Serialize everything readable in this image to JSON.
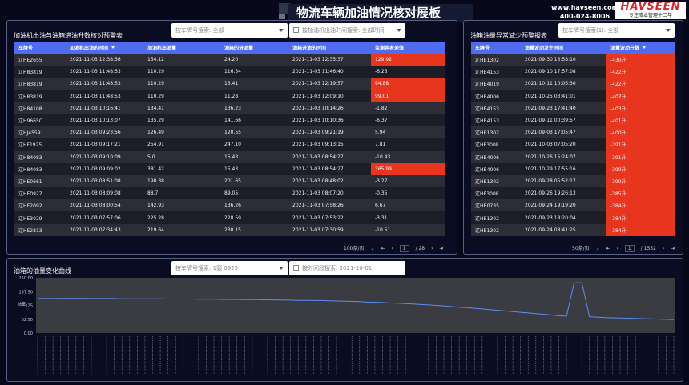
{
  "header": {
    "title": "物流车辆加油情况核对展板",
    "website": "www.havseen.com",
    "phone": "400-024-8006",
    "logo_text": "HAVSEEN",
    "logo_slogan": "专注成本管理十二年"
  },
  "left_panel": {
    "title": "加油机出油与油箱进油升数核对预警表",
    "filter_plate_placeholder": "按车牌号搜索: 全部",
    "filter_time_placeholder": "按加油机出油时间搜索: 全部时间",
    "columns": [
      "车牌号",
      "加油机出油的时间",
      "加油机出油量",
      "油箱的进油量",
      "油箱进油的时间",
      "监测两者差值"
    ],
    "rows": [
      {
        "plate": "辽HE2655",
        "pump_time": "2021-11-03 12:38:56",
        "pump_qty": "154.12",
        "tank_qty": "24.20",
        "tank_time": "2021-11-03 12:35:37",
        "diff": "129.92",
        "alert": true
      },
      {
        "plate": "辽H83819",
        "pump_time": "2021-11-03 11:48:53",
        "pump_qty": "110.29",
        "tank_qty": "116.54",
        "tank_time": "2021-11-03 11:46:40",
        "diff": "-6.25",
        "alert": false
      },
      {
        "plate": "辽H83819",
        "pump_time": "2021-11-03 11:48:53",
        "pump_qty": "110.29",
        "tank_qty": "15.41",
        "tank_time": "2021-11-03 12:19:57",
        "diff": "94.88",
        "alert": true
      },
      {
        "plate": "辽H83819",
        "pump_time": "2021-11-03 11:48:53",
        "pump_qty": "110.29",
        "tank_qty": "11.28",
        "tank_time": "2021-11-03 12:09:10",
        "diff": "99.01",
        "alert": true
      },
      {
        "plate": "辽H84108",
        "pump_time": "2021-11-03 10:16:41",
        "pump_qty": "134.41",
        "tank_qty": "136.23",
        "tank_time": "2021-11-03 10:14:26",
        "diff": "-1.82",
        "alert": false
      },
      {
        "plate": "辽H9665C",
        "pump_time": "2021-11-03 10:13:07",
        "pump_qty": "135.29",
        "tank_qty": "141.66",
        "tank_time": "2021-11-03 10:10:36",
        "diff": "-6.37",
        "alert": false
      },
      {
        "plate": "辽HJ4559",
        "pump_time": "2021-11-03 09:23:56",
        "pump_qty": "126.49",
        "tank_qty": "120.55",
        "tank_time": "2021-11-03 09:21:19",
        "diff": "5.94",
        "alert": false
      },
      {
        "plate": "辽HF1925",
        "pump_time": "2021-11-03 09:17:21",
        "pump_qty": "254.91",
        "tank_qty": "247.10",
        "tank_time": "2021-11-03 09:13:15",
        "diff": "7.81",
        "alert": false
      },
      {
        "plate": "辽H84083",
        "pump_time": "2021-11-03 09:10:09",
        "pump_qty": "5.0",
        "tank_qty": "15.43",
        "tank_time": "2021-11-03 08:54:27",
        "diff": "-10.43",
        "alert": false
      },
      {
        "plate": "辽H84083",
        "pump_time": "2021-11-03 09:09:02",
        "pump_qty": "381.42",
        "tank_qty": "15.43",
        "tank_time": "2021-11-03 08:54:27",
        "diff": "365.99",
        "alert": true
      },
      {
        "plate": "辽HE0661",
        "pump_time": "2021-11-03 08:51:08",
        "pump_qty": "198.38",
        "tank_qty": "201.65",
        "tank_time": "2021-11-03 08:48:02",
        "diff": "-3.27",
        "alert": false
      },
      {
        "plate": "辽HE0927",
        "pump_time": "2021-11-03 08:09:08",
        "pump_qty": "88.7",
        "tank_qty": "89.05",
        "tank_time": "2021-11-03 08:07:20",
        "diff": "-0.35",
        "alert": false
      },
      {
        "plate": "辽HE2092",
        "pump_time": "2021-11-03 08:00:54",
        "pump_qty": "142.93",
        "tank_qty": "136.26",
        "tank_time": "2021-11-03 07:58:26",
        "diff": "6.67",
        "alert": false
      },
      {
        "plate": "辽HE3029",
        "pump_time": "2021-11-03 07:57:06",
        "pump_qty": "225.28",
        "tank_qty": "228.59",
        "tank_time": "2021-11-03 07:53:22",
        "diff": "-3.31",
        "alert": false
      },
      {
        "plate": "辽HE2813",
        "pump_time": "2021-11-03 07:34:43",
        "pump_qty": "219.64",
        "tank_qty": "230.15",
        "tank_time": "2021-11-03 07:30:59",
        "diff": "-10.51",
        "alert": false
      }
    ],
    "pager": {
      "page_size": "100条/页",
      "current_page": "1",
      "total_pages": "/ 28"
    }
  },
  "right_panel": {
    "title": "油箱油量异常减少预警报表",
    "filter_plate_placeholder": "按车牌号搜索(1): 全部",
    "columns": [
      "车牌号",
      "油量波动发生时间",
      "油量波动升数"
    ],
    "rows": [
      {
        "plate": "辽HB1302",
        "time": "2021-09-30 13:58:10",
        "amount": "-430升"
      },
      {
        "plate": "辽HB4153",
        "time": "2021-09-10 17:57:08",
        "amount": "-422升"
      },
      {
        "plate": "辽HB4019",
        "time": "2021-10-11 10:05:30",
        "amount": "-422升"
      },
      {
        "plate": "辽HB4006",
        "time": "2021-10-25 03:41:01",
        "amount": "-407升"
      },
      {
        "plate": "辽HB4153",
        "time": "2021-09-23 17:41:40",
        "amount": "-403升"
      },
      {
        "plate": "辽HB4153",
        "time": "2021-09-11 00:39:57",
        "amount": "-401升"
      },
      {
        "plate": "辽HB1302",
        "time": "2021-09-03 17:05:47",
        "amount": "-400升"
      },
      {
        "plate": "辽HE3008",
        "time": "2021-10-03 07:05:20",
        "amount": "-391升"
      },
      {
        "plate": "辽HB4006",
        "time": "2021-10-26 15:24:07",
        "amount": "-391升"
      },
      {
        "plate": "辽HB4006",
        "time": "2021-10-29 17:55:16",
        "amount": "-390升"
      },
      {
        "plate": "辽HB1302",
        "time": "2021-09-28 05:52:17",
        "amount": "-390升"
      },
      {
        "plate": "辽HE3008",
        "time": "2021-09-26 19:26:13",
        "amount": "-385升"
      },
      {
        "plate": "辽HB0735",
        "time": "2021-09-24 19:19:20",
        "amount": "-384升"
      },
      {
        "plate": "辽HB1302",
        "time": "2021-09-23 18:20:04",
        "amount": "-384升"
      },
      {
        "plate": "辽HB1302",
        "time": "2021-09-24 08:41:25",
        "amount": "-384升"
      }
    ],
    "pager": {
      "page_size": "50条/页",
      "current_page": "1",
      "total_pages": "/ 1532"
    }
  },
  "bottom_panel": {
    "title": "油箱的油量变化曲线",
    "filter_plate_value": "按车牌号搜索: 1頭 0925",
    "filter_time_value": "按时间段搜索: 2021-10-01",
    "ylabel": "油量"
  },
  "chart_data": {
    "type": "line",
    "title": "",
    "xlabel": "",
    "ylabel": "油量",
    "ylim": [
      0,
      250
    ],
    "yticks": [
      "250.00",
      "187.50",
      "125",
      "62.50",
      "0.00"
    ],
    "x_count": 84,
    "series": [
      {
        "values": [
          156,
          156,
          156,
          157,
          157,
          157,
          157,
          156,
          156,
          156,
          156,
          155,
          155,
          155,
          155,
          155,
          155,
          154,
          154,
          154,
          154,
          153,
          153,
          153,
          152,
          152,
          152,
          151,
          151,
          151,
          150,
          150,
          149,
          149,
          148,
          148,
          147,
          147,
          146,
          145,
          144,
          143,
          142,
          140,
          139,
          138,
          136,
          135,
          133,
          131,
          129,
          127,
          125,
          123,
          120,
          117,
          115,
          112,
          109,
          106,
          103,
          100,
          97,
          94,
          91,
          88,
          85,
          82,
          78,
          76,
          227,
          228,
          74,
          72,
          70,
          69,
          68,
          67,
          66,
          65,
          64,
          63,
          62,
          61
        ],
        "color": "#5b8ff3"
      }
    ]
  }
}
